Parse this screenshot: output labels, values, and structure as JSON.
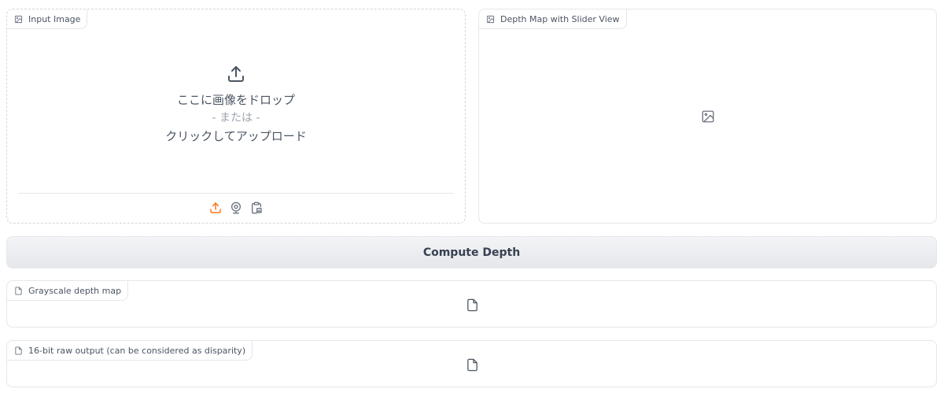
{
  "input_image": {
    "label": "Input Image",
    "drop_text": "ここに画像をドロップ",
    "or_text": "- または -",
    "click_text": "クリックしてアップロード",
    "sources": [
      "upload-icon",
      "webcam-icon",
      "clipboard-icon"
    ]
  },
  "depth_map": {
    "label": "Depth Map with Slider View"
  },
  "compute_button": {
    "label": "Compute Depth"
  },
  "grayscale_output": {
    "label": "Grayscale depth map"
  },
  "raw_output": {
    "label": "16-bit raw output (can be considered as disparity)"
  },
  "colors": {
    "accent": "#f97316",
    "border": "#e5e7eb",
    "text": "#374151"
  }
}
